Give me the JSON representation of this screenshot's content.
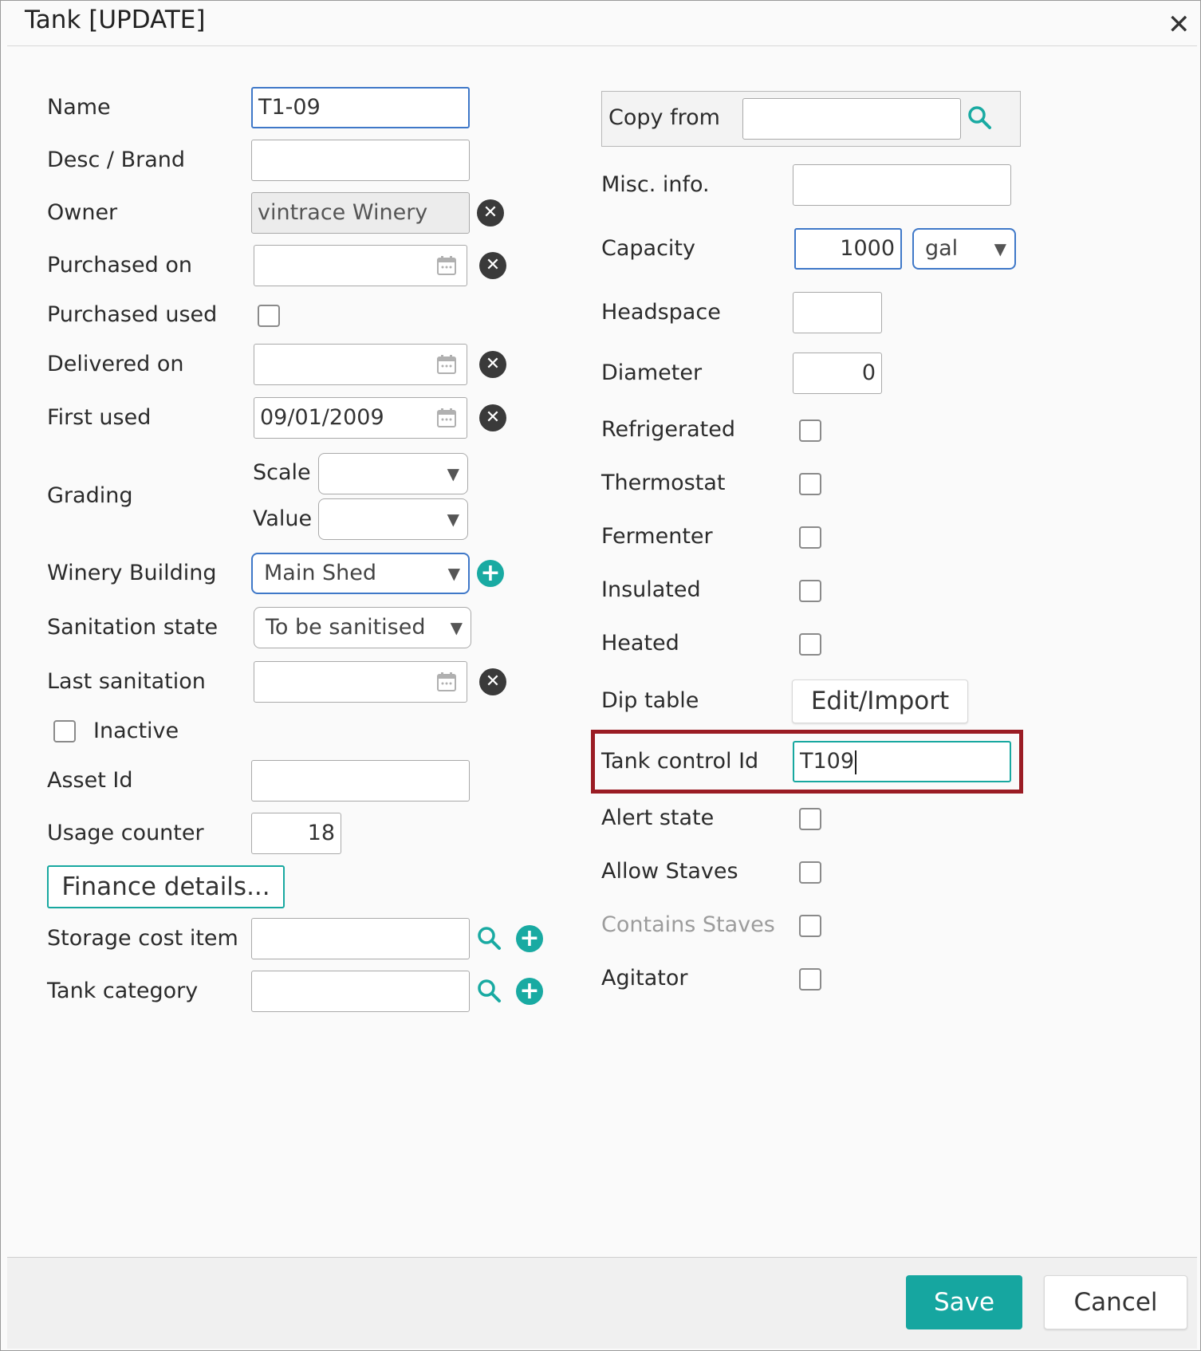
{
  "dialog": {
    "title": "Tank [UPDATE]",
    "close_symbol": "✕"
  },
  "left": {
    "name_label": "Name",
    "name_value": "T1-09",
    "desc_label": "Desc / Brand",
    "desc_value": "",
    "owner_label": "Owner",
    "owner_value": "vintrace Winery",
    "purchased_on_label": "Purchased on",
    "purchased_on_value": "",
    "purchased_used_label": "Purchased used",
    "delivered_on_label": "Delivered on",
    "delivered_on_value": "",
    "first_used_label": "First used",
    "first_used_value": "09/01/2009",
    "grading_label": "Grading",
    "scale_label": "Scale",
    "scale_value": "",
    "value_label": "Value",
    "value_value": "",
    "winery_building_label": "Winery Building",
    "winery_building_value": "Main Shed",
    "sanitation_state_label": "Sanitation state",
    "sanitation_state_value": "To be sanitised",
    "last_sanitation_label": "Last sanitation",
    "last_sanitation_value": "",
    "inactive_label": "Inactive",
    "asset_id_label": "Asset Id",
    "asset_id_value": "",
    "usage_counter_label": "Usage counter",
    "usage_counter_value": "18",
    "finance_button": "Finance details...",
    "storage_cost_label": "Storage cost item",
    "storage_cost_value": "",
    "tank_category_label": "Tank category",
    "tank_category_value": ""
  },
  "right": {
    "copy_from_label": "Copy from",
    "copy_from_value": "",
    "misc_info_label": "Misc. info.",
    "misc_info_value": "",
    "capacity_label": "Capacity",
    "capacity_value": "1000",
    "capacity_unit": "gal",
    "headspace_label": "Headspace",
    "headspace_value": "",
    "diameter_label": "Diameter",
    "diameter_value": "0",
    "refrigerated_label": "Refrigerated",
    "thermostat_label": "Thermostat",
    "fermenter_label": "Fermenter",
    "insulated_label": "Insulated",
    "heated_label": "Heated",
    "dip_table_label": "Dip table",
    "dip_table_button": "Edit/Import",
    "tank_control_id_label": "Tank control Id",
    "tank_control_id_value": "T109",
    "alert_state_label": "Alert state",
    "allow_staves_label": "Allow Staves",
    "contains_staves_label": "Contains Staves",
    "agitator_label": "Agitator"
  },
  "footer": {
    "save_label": "Save",
    "cancel_label": "Cancel"
  },
  "icons": {
    "clear": "✕",
    "add": "+",
    "dropdown": "▼"
  },
  "colors": {
    "accent_teal": "#16a6a0",
    "focus_blue": "#3f78c8",
    "highlight_red": "#9a1c24"
  }
}
